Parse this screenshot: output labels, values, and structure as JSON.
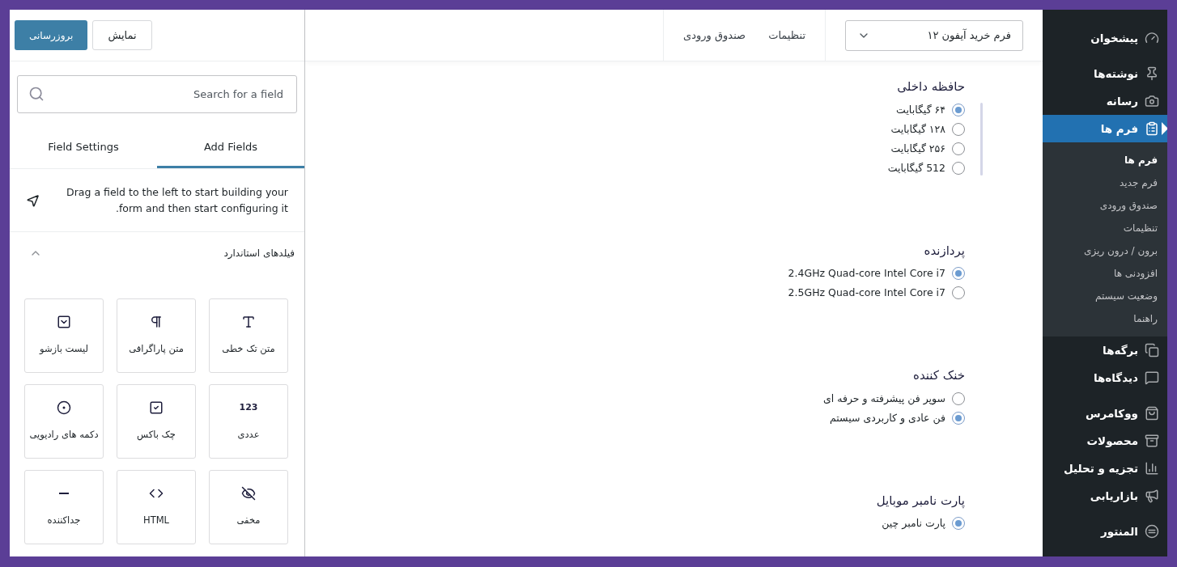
{
  "left_panel": {
    "buttons": [
      {
        "label": "نمایش",
        "kind": "secondary"
      },
      {
        "label": "بروزرسانی",
        "kind": "primary"
      }
    ],
    "search": {
      "placeholder": "Search for a field"
    },
    "tabs": [
      {
        "label": "Add Fields",
        "selected": true
      },
      {
        "label": "Field Settings",
        "selected": false
      }
    ],
    "hint": "Drag a field to the left to start building your form and then start configuring it.",
    "section": {
      "title": "فیلدهای استاندارد",
      "expanded": true,
      "fields": [
        {
          "label": "متن تک خطی"
        },
        {
          "label": "متن پاراگرافی"
        },
        {
          "label": "لیست بازشو"
        },
        {
          "label": "عددی",
          "glyph": "123"
        },
        {
          "label": "چک باکس"
        },
        {
          "label": "دکمه های رادیویی"
        },
        {
          "label": "مخفی"
        },
        {
          "label": "HTML"
        },
        {
          "label": "جداکننده"
        }
      ]
    }
  },
  "header": {
    "form_select": "فرم خرید آیفون ۱۲",
    "links": [
      "تنظیمات",
      "صندوق ورودی"
    ]
  },
  "form": [
    {
      "title": "حافظه داخلی",
      "selected": true,
      "options": [
        {
          "label": "۶۴ گیگابایت",
          "selected": true
        },
        {
          "label": "۱۲۸ گیگابایت",
          "selected": false
        },
        {
          "label": "۲۵۶ گیگابایت",
          "selected": false
        },
        {
          "label": "512 گیگابایت",
          "selected": false
        }
      ]
    },
    {
      "title": "پردازنده",
      "selected": false,
      "options": [
        {
          "label": "2.4GHz Quad-core Intel Core i7",
          "selected": true
        },
        {
          "label": "2.5GHz Quad-core Intel Core i7",
          "selected": false
        }
      ]
    },
    {
      "title": "خنک کننده",
      "selected": false,
      "options": [
        {
          "label": "سوپر فن پیشرفته و حرفه ای",
          "selected": false
        },
        {
          "label": "فن عادی و کاربردی سیستم",
          "selected": true
        }
      ]
    },
    {
      "title": "پارت نامبر موبایل",
      "selected": false,
      "options": [
        {
          "label": "پارت نامبر چین",
          "selected": true
        }
      ]
    }
  ],
  "sidebar": {
    "groups": [
      [
        {
          "label": "پیشخوان",
          "selected": false
        }
      ],
      [
        {
          "label": "نوشته‌ها",
          "selected": false
        },
        {
          "label": "رسانه",
          "selected": false
        },
        {
          "label": "فرم ها",
          "selected": true,
          "children": [
            {
              "label": "فرم ها",
              "selected": true
            },
            {
              "label": "فرم جدید",
              "selected": false
            },
            {
              "label": "صندوق ورودی",
              "selected": false
            },
            {
              "label": "تنظیمات",
              "selected": false
            },
            {
              "label": "برون / درون ریزی",
              "selected": false
            },
            {
              "label": "افزودنی ها",
              "selected": false
            },
            {
              "label": "وضعیت سیستم",
              "selected": false
            },
            {
              "label": "راهنما",
              "selected": false
            }
          ]
        },
        {
          "label": "برگه‌ها",
          "selected": false
        },
        {
          "label": "دیدگاه‌ها",
          "selected": false
        }
      ],
      [
        {
          "label": "ووکامرس",
          "selected": false
        },
        {
          "label": "محصولات",
          "selected": false
        },
        {
          "label": "تجزیه و تحلیل",
          "selected": false
        },
        {
          "label": "بازاریابی",
          "selected": false
        }
      ],
      [
        {
          "label": "المنتور",
          "selected": false
        }
      ]
    ]
  }
}
